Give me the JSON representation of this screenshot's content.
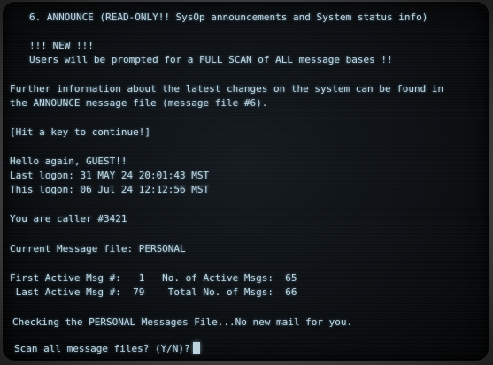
{
  "terminal": {
    "announce_header": "6. ANNOUNCE (READ-ONLY!! SysOp announcements and System status info)",
    "new_banner": "!!! NEW !!!",
    "full_scan_notice": "Users will be prompted for a FULL SCAN of ALL message bases !!",
    "info_line_1": "Further information about the latest changes on the system can be found in",
    "info_line_2": "the ANNOUNCE message file (message file #6).",
    "hit_key_prompt": "[Hit a key to continue!]",
    "greeting": "Hello again, GUEST!!",
    "last_logon": "Last logon: 31 MAY 24 20:01:43 MST",
    "this_logon": "This logon: 06 Jul 24 12:12:56 MST",
    "caller_number": "You are caller #3421",
    "current_message_file": "Current Message file: PERSONAL",
    "first_active_line": "First Active Msg #:   1   No. of Active Msgs:  65",
    "last_active_line": " Last Active Msg #:  79    Total No. of Msgs:  66",
    "mail_check": "Checking the PERSONAL Messages File...No new mail for you.",
    "scan_prompt": "Scan all message files? (Y/N)?"
  },
  "colors": {
    "phosphor_text": "#bcd3e0",
    "screen_background": "#0a0d10"
  }
}
